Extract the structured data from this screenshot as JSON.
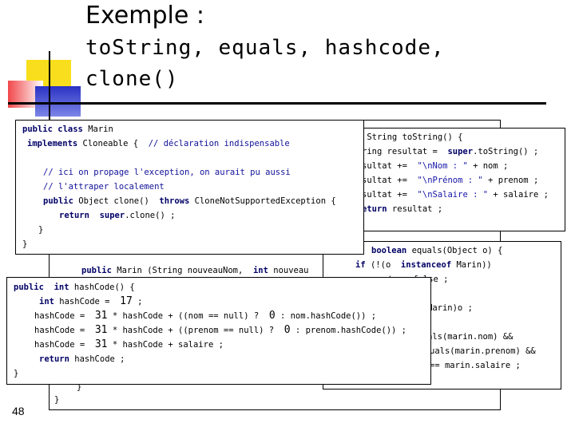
{
  "slide": {
    "title": "Exemple :",
    "subtitle_line1": "toString, equals, hashcode,",
    "subtitle_line2": "clone()",
    "page_number": "48"
  },
  "code": {
    "clone": {
      "l1": {
        "a": "public",
        "b": " ",
        "c": "class",
        "d": " Marin"
      },
      "l2": {
        "a": "implements",
        "b": " Cloneable {  ",
        "c": "// déclaration indispensable"
      },
      "l3": "// ici on propage l'exception, on aurait pu aussi",
      "l4": "// l'attraper localement",
      "l5": {
        "a": "public",
        "b": " Object clone()  ",
        "c": "throws",
        "d": " CloneNotSupportedException {"
      },
      "l6": {
        "a": "return",
        "b": "  ",
        "c": "super",
        "d": ".clone() ;"
      },
      "l7": "}",
      "l8": "}"
    },
    "tostring": {
      "l1": " String toString() {",
      "l2": {
        "a": "ring resultat =  ",
        "b": "super",
        "c": ".toString() ;"
      },
      "l3": {
        "a": "sultat +=  ",
        "b": "\"\\nNom : \"",
        "c": " + nom ;"
      },
      "l4": {
        "a": "sultat +=  ",
        "b": "\"\\nPrénom : \"",
        "c": " + prenom ;"
      },
      "l5": {
        "a": "sultat +=  ",
        "b": "\"\\nSalaire : \"",
        "c": " + salaire ;"
      },
      "l6": {
        "a": "eturn",
        "b": " resultat ;"
      }
    },
    "equals": {
      "l1": {
        "a": "boolean",
        "b": " equals(Object o) {"
      },
      "l2": {
        "a": "if",
        "b": " (!(o  ",
        "c": "instanceof",
        "d": " Marin))"
      },
      "l3": "return false ;",
      "l4": "Marin)o ;",
      "l5": "als(marin.nom) &&",
      "l6": "uals(marin.prenom) &&",
      "l7": "== marin.salaire ;"
    },
    "constructor": {
      "l1": {
        "a": "public",
        "b": " Marin (String nouveauNom,  ",
        "c": "int",
        "d": " nouveau"
      },
      "l2": "}",
      "l3": "}"
    },
    "hashcode": {
      "l1": {
        "a": "public",
        "b": "  ",
        "c": "int",
        "d": " hashCode() {"
      },
      "l2": {
        "a": "int",
        "b": " hashCode =  ",
        "c": "17",
        "d": " ;"
      },
      "l3": {
        "a": "hashCode =  ",
        "b": "31",
        "c": " * hashCode + ((nom == null) ?  ",
        "d": "0",
        "e": " : nom.hashCode()) ;"
      },
      "l4": {
        "a": "hashCode =  ",
        "b": "31",
        "c": " * hashCode + ((prenom == null) ?  ",
        "d": "0",
        "e": " : prenom.hashCode()) ;"
      },
      "l5": {
        "a": "hashCode =  ",
        "b": "31",
        "c": " * hashCode + salaire ;"
      },
      "l6": {
        "a": "return",
        "b": " hashCode ;"
      },
      "l7": "}",
      "l8": "}"
    }
  }
}
